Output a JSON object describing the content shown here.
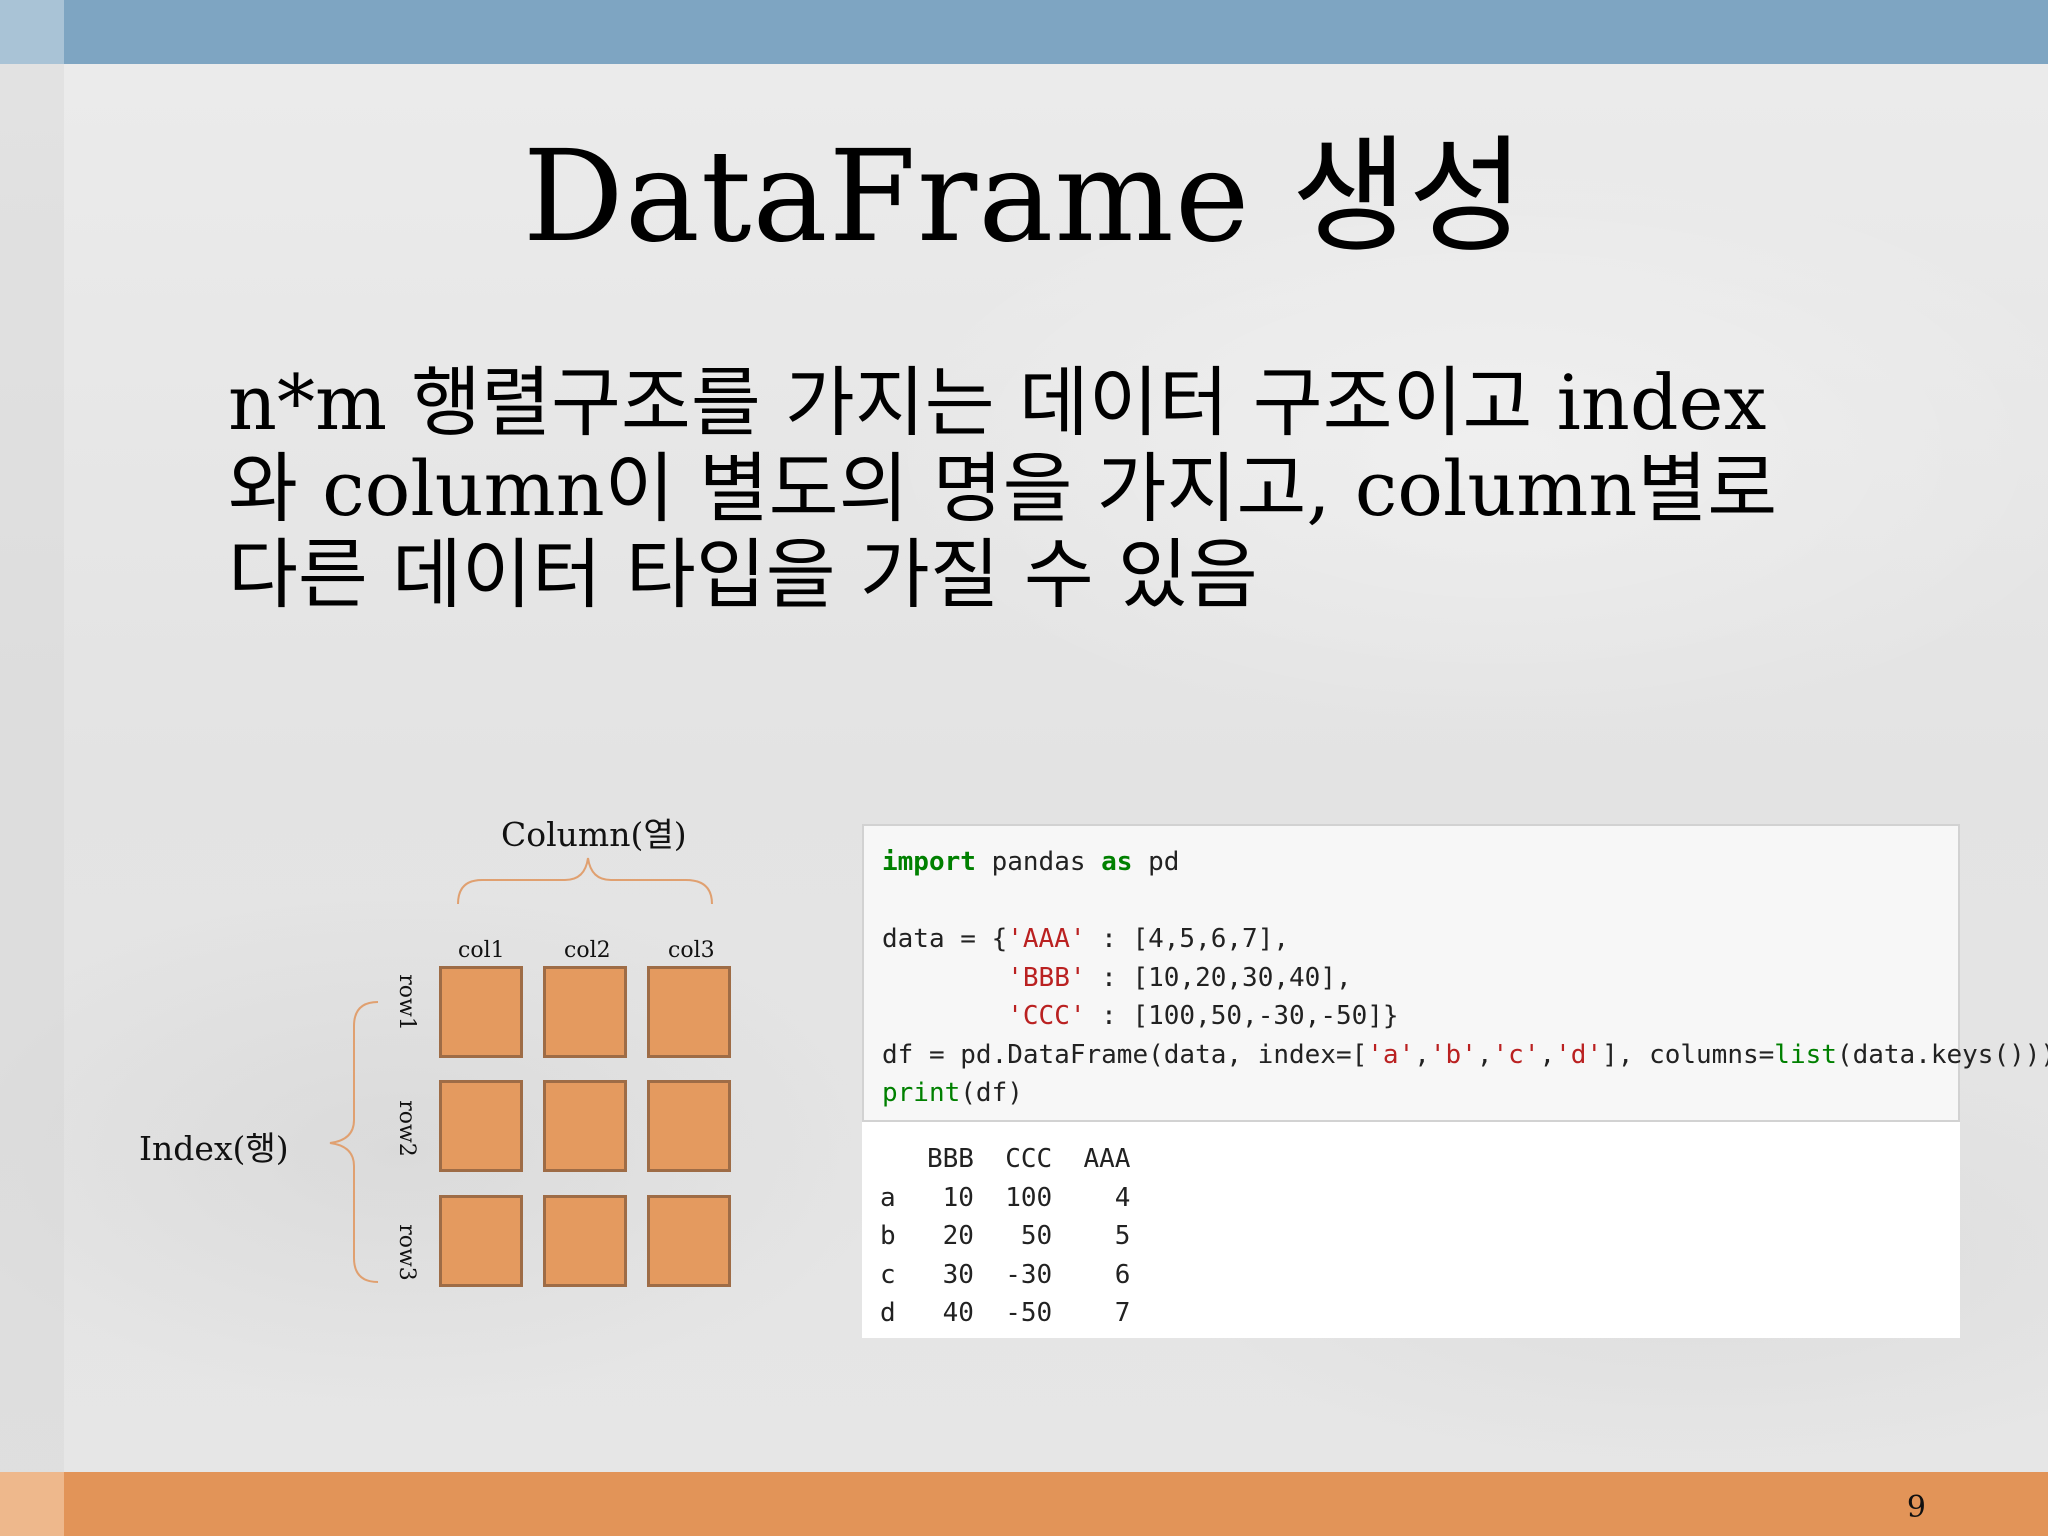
{
  "slide": {
    "title": "DataFrame 생성",
    "page_number": "9",
    "body_lines": [
      "n*m 행렬구조를 가지는 데이터 구조이고 index",
      "와 column이 별도의 명을 가지고, column별로",
      "다른 데이터 타입을 가질 수 있음"
    ]
  },
  "diagram": {
    "column_caption": "Column(열)",
    "index_caption": "Index(행)",
    "columns": [
      "col1",
      "col2",
      "col3"
    ],
    "rows": [
      "row1",
      "row2",
      "row3"
    ]
  },
  "code": {
    "lines": [
      "import pandas as pd",
      "",
      "data = {'AAA' : [4,5,6,7],",
      "        'BBB' : [10,20,30,40],",
      "        'CCC' : [100,50,-30,-50]}",
      "df = pd.DataFrame(data, index=['a','b','c','d'], columns=list(data.keys()))",
      "print(df)"
    ],
    "output": [
      "   BBB  CCC  AAA",
      "a   10  100    4",
      "b   20   50    5",
      "c   30  -30    6",
      "d   40  -50    7"
    ]
  },
  "colors": {
    "top_bar": "#7ea5c2",
    "bottom_bar": "#e29458",
    "cell_fill": "#e49a5f",
    "cell_border": "#9e6c46",
    "brace": "#e0a070"
  }
}
